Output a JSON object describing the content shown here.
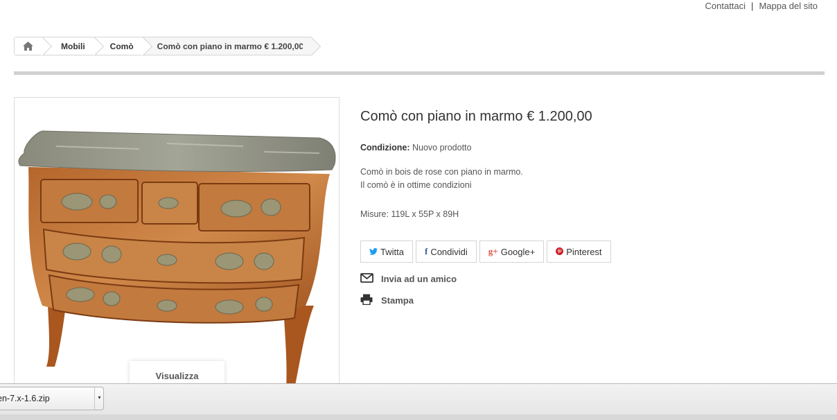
{
  "top_links": {
    "contact": "Contattaci",
    "separator": "|",
    "sitemap": "Mappa del sito"
  },
  "breadcrumb": {
    "home_icon": "home-icon",
    "items": [
      "Mobili",
      "Comò"
    ],
    "current": "Comò con piano in marmo € 1.200,00"
  },
  "product": {
    "image_alt": "Comò in bois de rose con piano in marmo",
    "view_button": "Visualizza",
    "title": "Comò con piano in marmo € 1.200,00",
    "condition_label": "Condizione:",
    "condition_value": "Nuovo prodotto",
    "description_line1": "Comò in bois de rose con piano in marmo.",
    "description_line2": "Il comò è in ottime condizioni",
    "measures": "Misure: 119L x 55P x 89H"
  },
  "social": [
    {
      "icon": "twitter-icon",
      "label": "Twitta"
    },
    {
      "icon": "facebook-icon",
      "label": "Condividi"
    },
    {
      "icon": "google-plus-icon",
      "label": "Google+"
    },
    {
      "icon": "pinterest-icon",
      "label": "Pinterest"
    }
  ],
  "actions": {
    "send_friend": "Invia ad un amico",
    "print": "Stampa"
  },
  "download_bar": {
    "file_name": "en-7.x-1.6.zip",
    "arrow": "▾"
  },
  "colors": {
    "twitter": "#1d9bf0",
    "facebook": "#3b5998",
    "google_plus": "#dd4b39",
    "pinterest": "#cb2027"
  }
}
